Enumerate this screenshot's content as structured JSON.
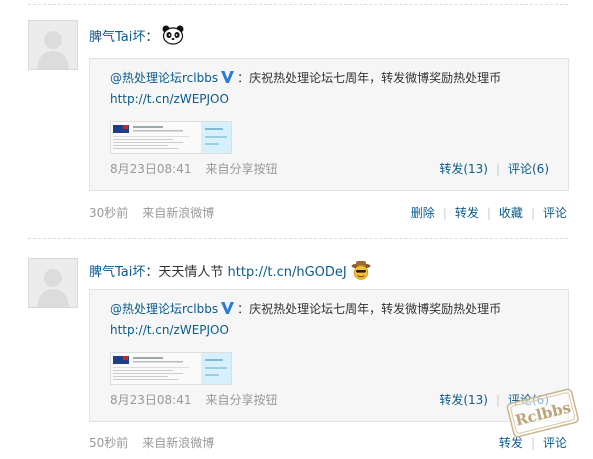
{
  "posts": [
    {
      "author": "脾气Tai坏",
      "colon": "：",
      "text": "",
      "link": "",
      "emoticon": "panda-icon",
      "forward": {
        "author": "@热处理论坛rclbbs",
        "colon": "：",
        "text": "庆祝热处理论坛七周年，转发微博奖励热处理币",
        "url": "http://t.cn/zWEPJOO",
        "date": "8月23日08:41",
        "source": "来自分享按钮",
        "actions": [
          "转发(13)",
          "评论(6)"
        ]
      },
      "time": "30秒前",
      "source": "来自新浪微博",
      "actions": [
        "删除",
        "转发",
        "收藏",
        "评论"
      ]
    },
    {
      "author": "脾气Tai坏",
      "colon": "：",
      "text": "天天情人节 ",
      "link": "http://t.cn/hGODeJ",
      "emoticon": "cowboy-face-icon",
      "forward": {
        "author": "@热处理论坛rclbbs",
        "colon": "：",
        "text": "庆祝热处理论坛七周年，转发微博奖励热处理币",
        "url": "http://t.cn/zWEPJOO",
        "date": "8月23日08:41",
        "source": "来自分享按钮",
        "actions": [
          "转发(13)",
          "评论(6)"
        ]
      },
      "time": "50秒前",
      "source": "来自新浪微博",
      "actions": [
        "转发",
        "评论"
      ]
    }
  ],
  "watermark": {
    "text": "Rclbbs"
  },
  "colors": {
    "link": "#0a5b8a",
    "meta": "#999999",
    "forward_bg": "#f6f6f6",
    "separator": "#dcdcdc"
  }
}
